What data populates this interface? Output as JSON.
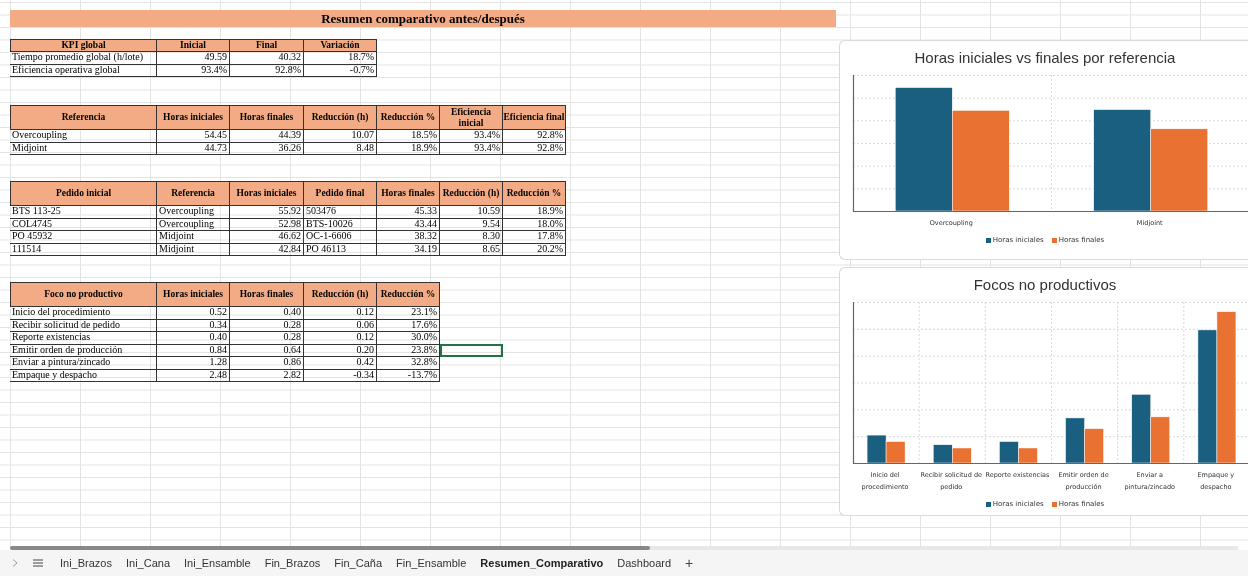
{
  "title": "Resumen comparativo antes/después",
  "tables": [
    {
      "columns": [
        {
          "label": "KPI global",
          "kind": "text"
        },
        {
          "label": "Inicial",
          "kind": "number"
        },
        {
          "label": "Final",
          "kind": "number"
        },
        {
          "label": "Variación",
          "kind": "number"
        }
      ],
      "rows": [
        [
          "Tiempo promedio global (h/lote)",
          "49.59",
          "40.32",
          "18.7%"
        ],
        [
          "Eficiencia operativa global",
          "93.4%",
          "92.8%",
          "-0.7%"
        ]
      ]
    },
    {
      "columns": [
        {
          "label": "Referencia",
          "kind": "text"
        },
        {
          "label": "Horas iniciales",
          "kind": "number"
        },
        {
          "label": "Horas finales",
          "kind": "number"
        },
        {
          "label": "Reducción (h)",
          "kind": "number"
        },
        {
          "label": "Reducción %",
          "kind": "number"
        },
        {
          "label": "Eficiencia inicial",
          "kind": "number"
        },
        {
          "label": "Eficiencia final",
          "kind": "number"
        }
      ],
      "rows": [
        [
          "Overcoupling",
          "54.45",
          "44.39",
          "10.07",
          "18.5%",
          "93.4%",
          "92.8%"
        ],
        [
          "Midjoint",
          "44.73",
          "36.26",
          "8.48",
          "18.9%",
          "93.4%",
          "92.8%"
        ]
      ]
    },
    {
      "columns": [
        {
          "label": "Pedido inicial",
          "kind": "text"
        },
        {
          "label": "Referencia",
          "kind": "text"
        },
        {
          "label": "Horas iniciales",
          "kind": "number"
        },
        {
          "label": "Pedido final",
          "kind": "text"
        },
        {
          "label": "Horas finales",
          "kind": "number"
        },
        {
          "label": "Reducción (h)",
          "kind": "number"
        },
        {
          "label": "Reducción %",
          "kind": "number"
        }
      ],
      "rows": [
        [
          "BTS 113-25",
          "Overcoupling",
          "55.92",
          "503476",
          "45.33",
          "10.59",
          "18.9%"
        ],
        [
          "COL4745",
          "Overcoupling",
          "52.98",
          "BTS-10026",
          "43.44",
          "9.54",
          "18.0%"
        ],
        [
          "PO 45932",
          "Midjoint",
          "46.62",
          "OC-1-6606",
          "38.32",
          "8.30",
          "17.8%"
        ],
        [
          "111514",
          "Midjoint",
          "42.84",
          "PO 46113",
          "34.19",
          "8.65",
          "20.2%"
        ]
      ]
    },
    {
      "columns": [
        {
          "label": "Foco no productivo",
          "kind": "text"
        },
        {
          "label": "Horas iniciales",
          "kind": "number"
        },
        {
          "label": "Horas finales",
          "kind": "number"
        },
        {
          "label": "Reducción (h)",
          "kind": "number"
        },
        {
          "label": "Reducción %",
          "kind": "number"
        }
      ],
      "rows": [
        [
          "Inicio del procedimiento",
          "0.52",
          "0.40",
          "0.12",
          "23.1%"
        ],
        [
          "Recibir solicitud de pedido",
          "0.34",
          "0.28",
          "0.06",
          "17.6%"
        ],
        [
          "Reporte existencias",
          "0.40",
          "0.28",
          "0.12",
          "30.0%"
        ],
        [
          "Emitir orden de producción",
          "0.84",
          "0.64",
          "0.20",
          "23.8%"
        ],
        [
          "Enviar a pintura/zincado",
          "1.28",
          "0.86",
          "0.42",
          "32.8%"
        ],
        [
          "Empaque y despacho",
          "2.48",
          "2.82",
          "-0.34",
          "-13.7%"
        ]
      ],
      "active_cell_row": {
        "kind": "emitir"
      }
    }
  ],
  "charts": [
    {
      "title": "Horas iniciales vs finales por referencia",
      "categories": [
        "Overcoupling",
        "Midjoint"
      ],
      "legend": [
        {
          "name": "Horas iniciales",
          "color": "#1a5e80"
        },
        {
          "name": "Horas finales",
          "color": "#e97132"
        }
      ]
    },
    {
      "title": "Focos no productivos",
      "categories": [
        "Inicio del procedimiento",
        "Recibir solicitud de pedido",
        "Reporte existencias",
        "Emitir orden de producción",
        "Enviar a pintura/zincado",
        "Empaque y despacho"
      ],
      "legend": [
        {
          "name": "Horas iniciales",
          "color": "#1a5e80"
        },
        {
          "name": "Horas finales",
          "color": "#e97132"
        }
      ]
    }
  ],
  "sheet_tabs": [
    {
      "label": "Ini_Brazos",
      "selected": false
    },
    {
      "label": "Ini_Cana",
      "selected": false
    },
    {
      "label": "Ini_Ensamble",
      "selected": false
    },
    {
      "label": "Fin_Brazos",
      "selected": false
    },
    {
      "label": "Fin_Caña",
      "selected": false
    },
    {
      "label": "Fin_Ensamble",
      "selected": false
    },
    {
      "label": "Resumen_Comparativo",
      "selected": true
    },
    {
      "label": "Dashboard",
      "selected": false
    }
  ],
  "add_sheet": "+"
}
